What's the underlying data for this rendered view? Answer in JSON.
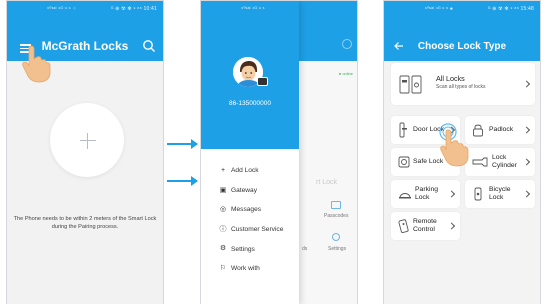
{
  "phone1": {
    "status_left": "⁶⁰ˢᵃˡ ⁴ᴳ ᵘ ⁶ ⁘",
    "status_right": "ᴳ ⊕ ☢ ✻ ⁹ ⁸⁸ 10:41",
    "title": "McGrath Locks",
    "pair_message": "The Phone needs to be within 2 meters of the Smart Lock during the Pairing process.",
    "icons": {
      "menu": "menu-icon",
      "search": "search-icon",
      "add": "plus-icon"
    }
  },
  "phone2": {
    "status_left": "⁶⁰ˢᵃˡ ⁴ᴳ ᵘ ⁶",
    "status_right": "ᴳ ⊕ ☢ ✻ ⁹ ⁸⁸ 15:50",
    "phone_number": "86-135000000",
    "menu": [
      {
        "label": "Add Lock",
        "icon": "+"
      },
      {
        "label": "Gateway",
        "icon": "▣"
      },
      {
        "label": "Messages",
        "icon": "◎"
      },
      {
        "label": "Customer Service",
        "icon": "ⓘ"
      },
      {
        "label": "Settings",
        "icon": "⚙"
      },
      {
        "label": "Work with",
        "icon": "⚐"
      }
    ],
    "background": {
      "online": "● online",
      "text": "rt Lock",
      "passcodes": "Passcodes",
      "settings": "Settings",
      "ds": "ds"
    }
  },
  "phone3": {
    "status_left": "⁶⁰ˢᵃˡ ⁴ᴳ ᵘ ⁶ ●",
    "status_right": "ᴳ ⊕ ☢ ✻ ⁹ ⁸⁸ 15:48",
    "title": "Choose Lock Type",
    "all_locks": {
      "label": "All Locks",
      "sub": "Scan all types of locks"
    },
    "items": [
      {
        "label": "Door Lock",
        "icon": "door-lock-icon"
      },
      {
        "label": "Padlock",
        "icon": "padlock-icon"
      },
      {
        "label": "Safe Lock",
        "icon": "safe-lock-icon"
      },
      {
        "label": "Lock Cylinder",
        "icon": "lock-cylinder-icon"
      },
      {
        "label": "Parking Lock",
        "icon": "parking-lock-icon"
      },
      {
        "label": "Bicycle Lock",
        "icon": "bicycle-lock-icon"
      },
      {
        "label": "Remote Control",
        "icon": "remote-control-icon"
      }
    ]
  },
  "colors": {
    "primary": "#1ea0e6",
    "hand": "#f2c08e"
  }
}
